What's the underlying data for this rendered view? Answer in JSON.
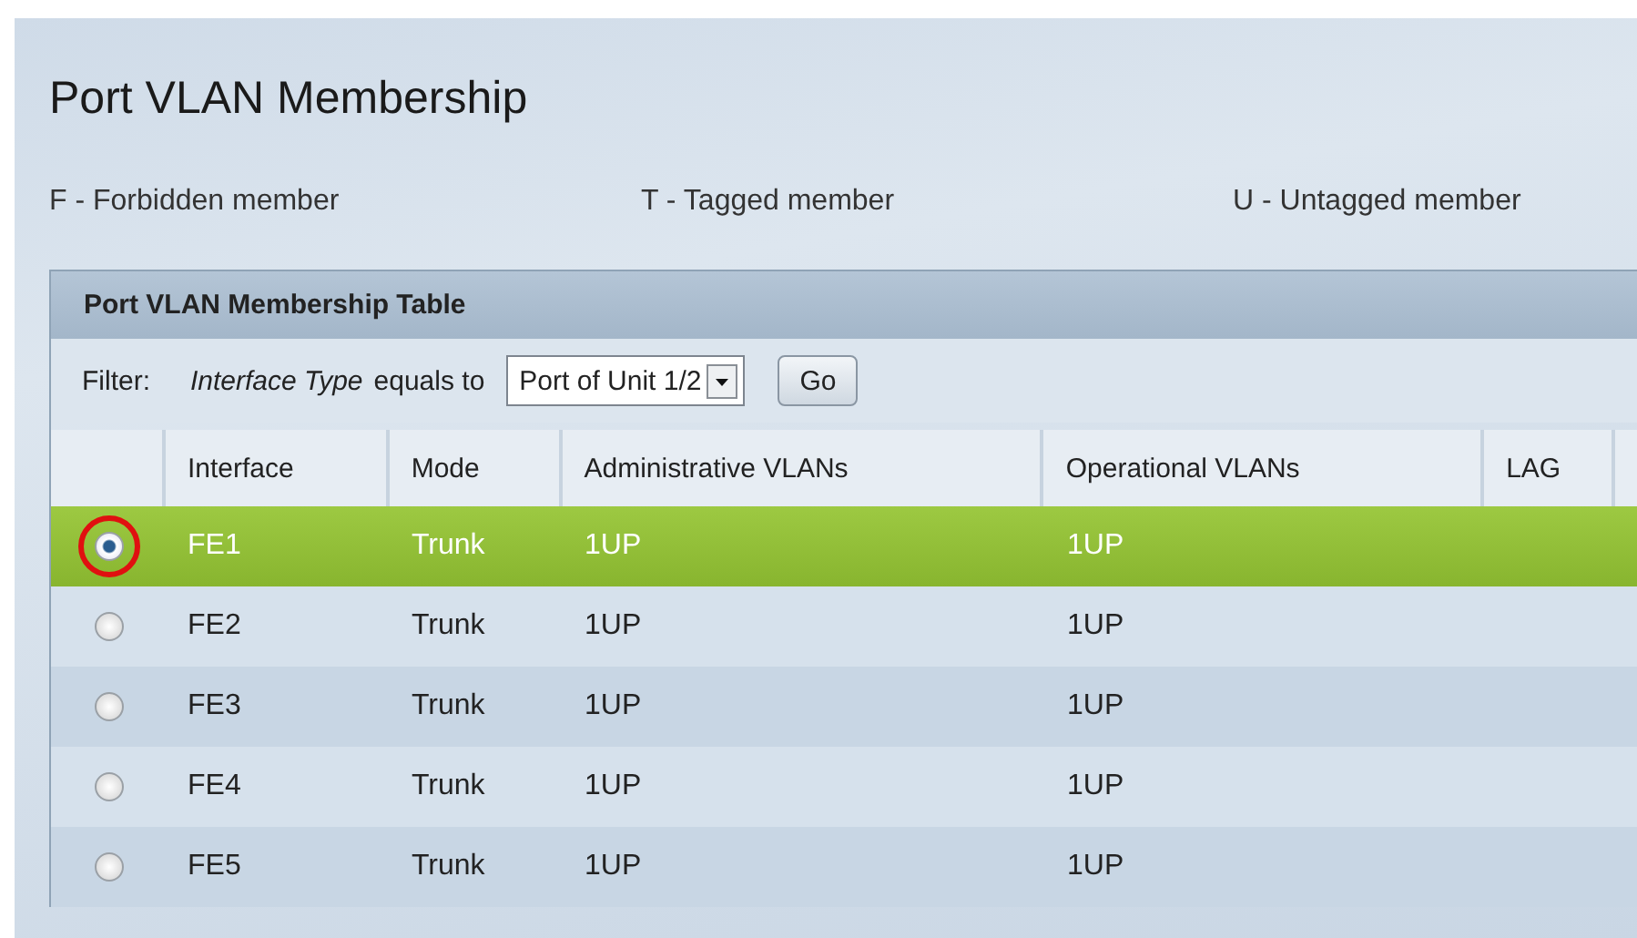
{
  "title": "Port VLAN Membership",
  "legend": [
    "F - Forbidden member",
    "T - Tagged member",
    "U - Untagged member"
  ],
  "table": {
    "title": "Port VLAN Membership Table",
    "filter": {
      "label": "Filter:",
      "field": "Interface Type",
      "operator": "equals to",
      "value": "Port of Unit 1/2",
      "button": "Go"
    },
    "columns": [
      "Interface",
      "Mode",
      "Administrative VLANs",
      "Operational VLANs",
      "LAG"
    ],
    "rows": [
      {
        "selected": true,
        "circled": true,
        "cells": [
          "FE1",
          "Trunk",
          "1UP",
          "1UP",
          ""
        ]
      },
      {
        "selected": false,
        "circled": false,
        "cells": [
          "FE2",
          "Trunk",
          "1UP",
          "1UP",
          ""
        ]
      },
      {
        "selected": false,
        "circled": false,
        "cells": [
          "FE3",
          "Trunk",
          "1UP",
          "1UP",
          ""
        ]
      },
      {
        "selected": false,
        "circled": false,
        "cells": [
          "FE4",
          "Trunk",
          "1UP",
          "1UP",
          ""
        ]
      },
      {
        "selected": false,
        "circled": false,
        "cells": [
          "FE5",
          "Trunk",
          "1UP",
          "1UP",
          ""
        ]
      }
    ]
  }
}
